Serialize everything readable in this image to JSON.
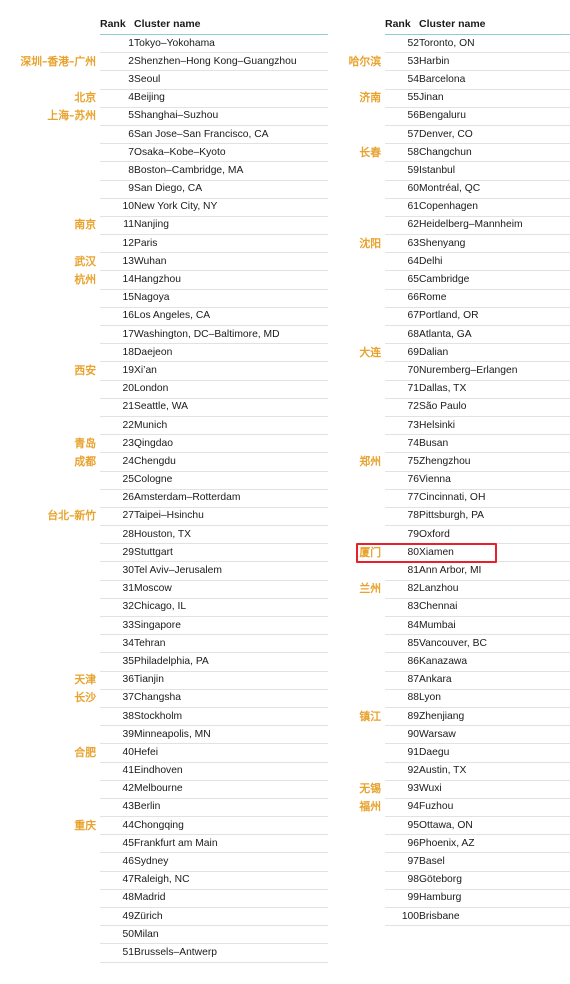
{
  "figure": {
    "kind": "two-column-rank-table",
    "accent_header_rule": "#8ecdd0",
    "row_rule": "#e2e2e2",
    "cn_label_color": "#e8a32e",
    "highlight_color": "#e8202a",
    "highlighted_rank": 80
  },
  "columns": [
    {
      "id": "left",
      "header": {
        "rank": "Rank",
        "cluster": "Cluster name"
      },
      "rows": [
        {
          "rank": "1",
          "name": "Tokyo–Yokohama",
          "cn": ""
        },
        {
          "rank": "2",
          "name": "Shenzhen–Hong Kong–Guangzhou",
          "cn": "深圳–香港–广州"
        },
        {
          "rank": "3",
          "name": "Seoul",
          "cn": ""
        },
        {
          "rank": "4",
          "name": "Beijing",
          "cn": "北京"
        },
        {
          "rank": "5",
          "name": "Shanghai–Suzhou",
          "cn": "上海–苏州"
        },
        {
          "rank": "6",
          "name": "San Jose–San Francisco, CA",
          "cn": ""
        },
        {
          "rank": "7",
          "name": "Osaka–Kobe–Kyoto",
          "cn": ""
        },
        {
          "rank": "8",
          "name": "Boston–Cambridge, MA",
          "cn": ""
        },
        {
          "rank": "9",
          "name": "San Diego, CA",
          "cn": ""
        },
        {
          "rank": "10",
          "name": "New York City, NY",
          "cn": ""
        },
        {
          "rank": "11",
          "name": "Nanjing",
          "cn": "南京"
        },
        {
          "rank": "12",
          "name": "Paris",
          "cn": ""
        },
        {
          "rank": "13",
          "name": "Wuhan",
          "cn": "武汉"
        },
        {
          "rank": "14",
          "name": "Hangzhou",
          "cn": "杭州"
        },
        {
          "rank": "15",
          "name": "Nagoya",
          "cn": ""
        },
        {
          "rank": "16",
          "name": "Los Angeles, CA",
          "cn": ""
        },
        {
          "rank": "17",
          "name": "Washington, DC–Baltimore, MD",
          "cn": ""
        },
        {
          "rank": "18",
          "name": "Daejeon",
          "cn": ""
        },
        {
          "rank": "19",
          "name": "Xi’an",
          "cn": "西安"
        },
        {
          "rank": "20",
          "name": "London",
          "cn": ""
        },
        {
          "rank": "21",
          "name": "Seattle, WA",
          "cn": ""
        },
        {
          "rank": "22",
          "name": "Munich",
          "cn": ""
        },
        {
          "rank": "23",
          "name": "Qingdao",
          "cn": "青岛"
        },
        {
          "rank": "24",
          "name": "Chengdu",
          "cn": "成都"
        },
        {
          "rank": "25",
          "name": "Cologne",
          "cn": ""
        },
        {
          "rank": "26",
          "name": "Amsterdam–Rotterdam",
          "cn": ""
        },
        {
          "rank": "27",
          "name": "Taipei–Hsinchu",
          "cn": "台北–新竹"
        },
        {
          "rank": "28",
          "name": "Houston, TX",
          "cn": ""
        },
        {
          "rank": "29",
          "name": "Stuttgart",
          "cn": ""
        },
        {
          "rank": "30",
          "name": "Tel Aviv–Jerusalem",
          "cn": ""
        },
        {
          "rank": "31",
          "name": "Moscow",
          "cn": ""
        },
        {
          "rank": "32",
          "name": "Chicago, IL",
          "cn": ""
        },
        {
          "rank": "33",
          "name": "Singapore",
          "cn": ""
        },
        {
          "rank": "34",
          "name": "Tehran",
          "cn": ""
        },
        {
          "rank": "35",
          "name": "Philadelphia, PA",
          "cn": ""
        },
        {
          "rank": "36",
          "name": "Tianjin",
          "cn": "天津"
        },
        {
          "rank": "37",
          "name": "Changsha",
          "cn": "长沙"
        },
        {
          "rank": "38",
          "name": "Stockholm",
          "cn": ""
        },
        {
          "rank": "39",
          "name": "Minneapolis, MN",
          "cn": ""
        },
        {
          "rank": "40",
          "name": "Hefei",
          "cn": "合肥"
        },
        {
          "rank": "41",
          "name": "Eindhoven",
          "cn": ""
        },
        {
          "rank": "42",
          "name": "Melbourne",
          "cn": ""
        },
        {
          "rank": "43",
          "name": "Berlin",
          "cn": ""
        },
        {
          "rank": "44",
          "name": "Chongqing",
          "cn": "重庆"
        },
        {
          "rank": "45",
          "name": "Frankfurt am Main",
          "cn": ""
        },
        {
          "rank": "46",
          "name": "Sydney",
          "cn": ""
        },
        {
          "rank": "47",
          "name": "Raleigh, NC",
          "cn": ""
        },
        {
          "rank": "48",
          "name": "Madrid",
          "cn": ""
        },
        {
          "rank": "49",
          "name": "Zürich",
          "cn": ""
        },
        {
          "rank": "50",
          "name": "Milan",
          "cn": ""
        },
        {
          "rank": "51",
          "name": "Brussels–Antwerp",
          "cn": ""
        }
      ]
    },
    {
      "id": "right",
      "header": {
        "rank": "Rank",
        "cluster": "Cluster name"
      },
      "rows": [
        {
          "rank": "52",
          "name": "Toronto, ON",
          "cn": ""
        },
        {
          "rank": "53",
          "name": "Harbin",
          "cn": "哈尔滨"
        },
        {
          "rank": "54",
          "name": "Barcelona",
          "cn": ""
        },
        {
          "rank": "55",
          "name": "Jinan",
          "cn": "济南"
        },
        {
          "rank": "56",
          "name": "Bengaluru",
          "cn": ""
        },
        {
          "rank": "57",
          "name": "Denver, CO",
          "cn": ""
        },
        {
          "rank": "58",
          "name": "Changchun",
          "cn": "长春"
        },
        {
          "rank": "59",
          "name": "Istanbul",
          "cn": ""
        },
        {
          "rank": "60",
          "name": "Montréal, QC",
          "cn": ""
        },
        {
          "rank": "61",
          "name": "Copenhagen",
          "cn": ""
        },
        {
          "rank": "62",
          "name": "Heidelberg–Mannheim",
          "cn": ""
        },
        {
          "rank": "63",
          "name": "Shenyang",
          "cn": "沈阳"
        },
        {
          "rank": "64",
          "name": "Delhi",
          "cn": ""
        },
        {
          "rank": "65",
          "name": "Cambridge",
          "cn": ""
        },
        {
          "rank": "66",
          "name": "Rome",
          "cn": ""
        },
        {
          "rank": "67",
          "name": "Portland, OR",
          "cn": ""
        },
        {
          "rank": "68",
          "name": "Atlanta, GA",
          "cn": ""
        },
        {
          "rank": "69",
          "name": "Dalian",
          "cn": "大连"
        },
        {
          "rank": "70",
          "name": "Nuremberg–Erlangen",
          "cn": ""
        },
        {
          "rank": "71",
          "name": "Dallas, TX",
          "cn": ""
        },
        {
          "rank": "72",
          "name": "São Paulo",
          "cn": ""
        },
        {
          "rank": "73",
          "name": "Helsinki",
          "cn": ""
        },
        {
          "rank": "74",
          "name": "Busan",
          "cn": ""
        },
        {
          "rank": "75",
          "name": "Zhengzhou",
          "cn": "郑州"
        },
        {
          "rank": "76",
          "name": "Vienna",
          "cn": ""
        },
        {
          "rank": "77",
          "name": "Cincinnati, OH",
          "cn": ""
        },
        {
          "rank": "78",
          "name": "Pittsburgh, PA",
          "cn": ""
        },
        {
          "rank": "79",
          "name": "Oxford",
          "cn": ""
        },
        {
          "rank": "80",
          "name": "Xiamen",
          "cn": "厦门",
          "highlight": true
        },
        {
          "rank": "81",
          "name": "Ann Arbor, MI",
          "cn": ""
        },
        {
          "rank": "82",
          "name": "Lanzhou",
          "cn": "兰州"
        },
        {
          "rank": "83",
          "name": "Chennai",
          "cn": ""
        },
        {
          "rank": "84",
          "name": "Mumbai",
          "cn": ""
        },
        {
          "rank": "85",
          "name": "Vancouver, BC",
          "cn": ""
        },
        {
          "rank": "86",
          "name": "Kanazawa",
          "cn": ""
        },
        {
          "rank": "87",
          "name": "Ankara",
          "cn": ""
        },
        {
          "rank": "88",
          "name": "Lyon",
          "cn": ""
        },
        {
          "rank": "89",
          "name": "Zhenjiang",
          "cn": "镇江"
        },
        {
          "rank": "90",
          "name": "Warsaw",
          "cn": ""
        },
        {
          "rank": "91",
          "name": "Daegu",
          "cn": ""
        },
        {
          "rank": "92",
          "name": "Austin, TX",
          "cn": ""
        },
        {
          "rank": "93",
          "name": "Wuxi",
          "cn": "无锡"
        },
        {
          "rank": "94",
          "name": "Fuzhou",
          "cn": "福州"
        },
        {
          "rank": "95",
          "name": "Ottawa, ON",
          "cn": ""
        },
        {
          "rank": "96",
          "name": "Phoenix, AZ",
          "cn": ""
        },
        {
          "rank": "97",
          "name": "Basel",
          "cn": ""
        },
        {
          "rank": "98",
          "name": "Göteborg",
          "cn": ""
        },
        {
          "rank": "99",
          "name": "Hamburg",
          "cn": ""
        },
        {
          "rank": "100",
          "name": "Brisbane",
          "cn": ""
        }
      ]
    }
  ]
}
